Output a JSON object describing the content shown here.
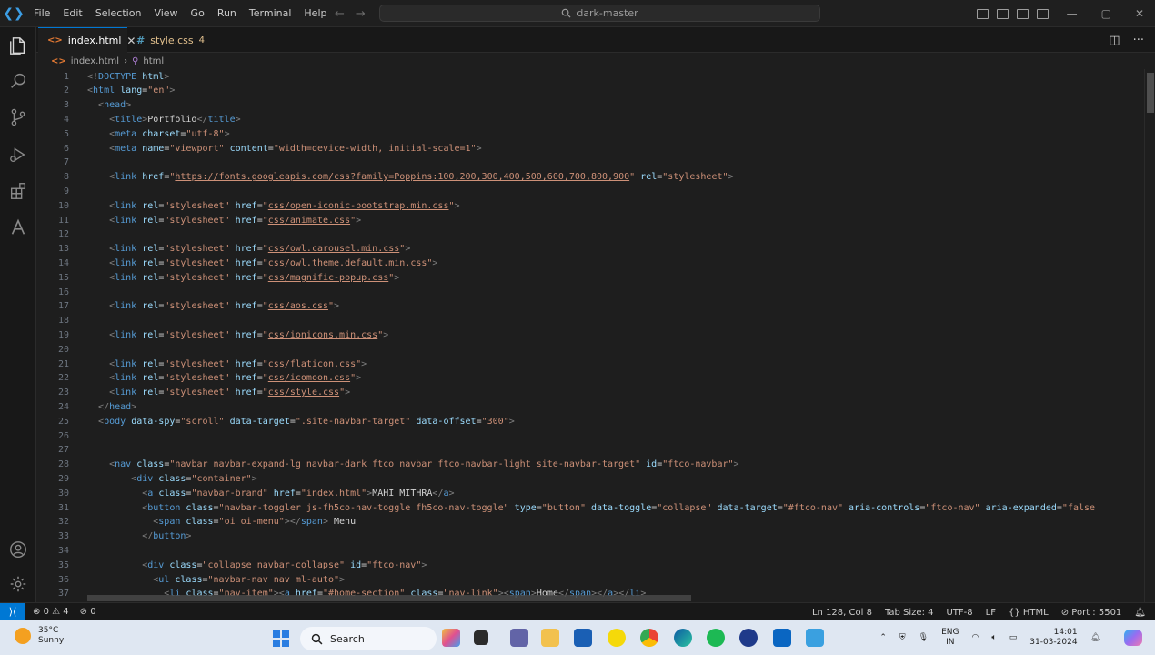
{
  "titlebar": {
    "menu": [
      "File",
      "Edit",
      "Selection",
      "View",
      "Go",
      "Run",
      "Terminal",
      "Help"
    ],
    "search": "dark-master"
  },
  "tabs": [
    {
      "label": "index.html",
      "icon": "html-file-icon",
      "active": true
    },
    {
      "label": "style.css",
      "badge": "4",
      "icon": "css-file-icon",
      "active": false
    }
  ],
  "breadcrumb": {
    "file": "index.html",
    "symbol": "html"
  },
  "editor": {
    "lines": [
      {
        "n": "1",
        "html": "<span class=\"p\">&lt;!</span><span class=\"t\">DOCTYPE</span> <span class=\"a\">html</span><span class=\"p\">&gt;</span>"
      },
      {
        "n": "2",
        "html": "<span class=\"p\">&lt;</span><span class=\"t\">html</span> <span class=\"a\">lang</span><span class=\"x\">=</span><span class=\"s\">\"en\"</span><span class=\"p\">&gt;</span>"
      },
      {
        "n": "3",
        "html": "  <span class=\"p\">&lt;</span><span class=\"t\">head</span><span class=\"p\">&gt;</span>"
      },
      {
        "n": "4",
        "html": "    <span class=\"p\">&lt;</span><span class=\"t\">title</span><span class=\"p\">&gt;</span><span class=\"x\">Portfolio</span><span class=\"p\">&lt;/</span><span class=\"t\">title</span><span class=\"p\">&gt;</span>"
      },
      {
        "n": "5",
        "html": "    <span class=\"p\">&lt;</span><span class=\"t\">meta</span> <span class=\"a\">charset</span><span class=\"x\">=</span><span class=\"s\">\"utf-8\"</span><span class=\"p\">&gt;</span>"
      },
      {
        "n": "6",
        "html": "    <span class=\"p\">&lt;</span><span class=\"t\">meta</span> <span class=\"a\">name</span><span class=\"x\">=</span><span class=\"s\">\"viewport\"</span> <span class=\"a\">content</span><span class=\"x\">=</span><span class=\"s\">\"width=device-width, initial-scale=1\"</span><span class=\"p\">&gt;</span>"
      },
      {
        "n": "7",
        "html": ""
      },
      {
        "n": "8",
        "html": "    <span class=\"p\">&lt;</span><span class=\"t\">link</span> <span class=\"a\">href</span><span class=\"x\">=</span><span class=\"s\">\"</span><span class=\"u\">https://fonts.googleapis.com/css?family=Poppins:100,200,300,400,500,600,700,800,900</span><span class=\"s\">\"</span> <span class=\"a\">rel</span><span class=\"x\">=</span><span class=\"s\">\"stylesheet\"</span><span class=\"p\">&gt;</span>"
      },
      {
        "n": "9",
        "html": ""
      },
      {
        "n": "10",
        "html": "    <span class=\"p\">&lt;</span><span class=\"t\">link</span> <span class=\"a\">rel</span><span class=\"x\">=</span><span class=\"s\">\"stylesheet\"</span> <span class=\"a\">href</span><span class=\"x\">=</span><span class=\"s\">\"</span><span class=\"u\">css/open-iconic-bootstrap.min.css</span><span class=\"s\">\"</span><span class=\"p\">&gt;</span>"
      },
      {
        "n": "11",
        "html": "    <span class=\"p\">&lt;</span><span class=\"t\">link</span> <span class=\"a\">rel</span><span class=\"x\">=</span><span class=\"s\">\"stylesheet\"</span> <span class=\"a\">href</span><span class=\"x\">=</span><span class=\"s\">\"</span><span class=\"u\">css/animate.css</span><span class=\"s\">\"</span><span class=\"p\">&gt;</span>"
      },
      {
        "n": "12",
        "html": ""
      },
      {
        "n": "13",
        "html": "    <span class=\"p\">&lt;</span><span class=\"t\">link</span> <span class=\"a\">rel</span><span class=\"x\">=</span><span class=\"s\">\"stylesheet\"</span> <span class=\"a\">href</span><span class=\"x\">=</span><span class=\"s\">\"</span><span class=\"u\">css/owl.carousel.min.css</span><span class=\"s\">\"</span><span class=\"p\">&gt;</span>"
      },
      {
        "n": "14",
        "html": "    <span class=\"p\">&lt;</span><span class=\"t\">link</span> <span class=\"a\">rel</span><span class=\"x\">=</span><span class=\"s\">\"stylesheet\"</span> <span class=\"a\">href</span><span class=\"x\">=</span><span class=\"s\">\"</span><span class=\"u\">css/owl.theme.default.min.css</span><span class=\"s\">\"</span><span class=\"p\">&gt;</span>"
      },
      {
        "n": "15",
        "html": "    <span class=\"p\">&lt;</span><span class=\"t\">link</span> <span class=\"a\">rel</span><span class=\"x\">=</span><span class=\"s\">\"stylesheet\"</span> <span class=\"a\">href</span><span class=\"x\">=</span><span class=\"s\">\"</span><span class=\"u\">css/magnific-popup.css</span><span class=\"s\">\"</span><span class=\"p\">&gt;</span>"
      },
      {
        "n": "16",
        "html": ""
      },
      {
        "n": "17",
        "html": "    <span class=\"p\">&lt;</span><span class=\"t\">link</span> <span class=\"a\">rel</span><span class=\"x\">=</span><span class=\"s\">\"stylesheet\"</span> <span class=\"a\">href</span><span class=\"x\">=</span><span class=\"s\">\"</span><span class=\"u\">css/aos.css</span><span class=\"s\">\"</span><span class=\"p\">&gt;</span>"
      },
      {
        "n": "18",
        "html": ""
      },
      {
        "n": "19",
        "html": "    <span class=\"p\">&lt;</span><span class=\"t\">link</span> <span class=\"a\">rel</span><span class=\"x\">=</span><span class=\"s\">\"stylesheet\"</span> <span class=\"a\">href</span><span class=\"x\">=</span><span class=\"s\">\"</span><span class=\"u\">css/ionicons.min.css</span><span class=\"s\">\"</span><span class=\"p\">&gt;</span>"
      },
      {
        "n": "20",
        "html": ""
      },
      {
        "n": "21",
        "html": "    <span class=\"p\">&lt;</span><span class=\"t\">link</span> <span class=\"a\">rel</span><span class=\"x\">=</span><span class=\"s\">\"stylesheet\"</span> <span class=\"a\">href</span><span class=\"x\">=</span><span class=\"s\">\"</span><span class=\"u\">css/flaticon.css</span><span class=\"s\">\"</span><span class=\"p\">&gt;</span>"
      },
      {
        "n": "22",
        "html": "    <span class=\"p\">&lt;</span><span class=\"t\">link</span> <span class=\"a\">rel</span><span class=\"x\">=</span><span class=\"s\">\"stylesheet\"</span> <span class=\"a\">href</span><span class=\"x\">=</span><span class=\"s\">\"</span><span class=\"u\">css/icomoon.css</span><span class=\"s\">\"</span><span class=\"p\">&gt;</span>"
      },
      {
        "n": "23",
        "html": "    <span class=\"p\">&lt;</span><span class=\"t\">link</span> <span class=\"a\">rel</span><span class=\"x\">=</span><span class=\"s\">\"stylesheet\"</span> <span class=\"a\">href</span><span class=\"x\">=</span><span class=\"s\">\"</span><span class=\"u\">css/style.css</span><span class=\"s\">\"</span><span class=\"p\">&gt;</span>"
      },
      {
        "n": "24",
        "html": "  <span class=\"p\">&lt;/</span><span class=\"t\">head</span><span class=\"p\">&gt;</span>"
      },
      {
        "n": "25",
        "html": "  <span class=\"p\">&lt;</span><span class=\"t\">body</span> <span class=\"a\">data-spy</span><span class=\"x\">=</span><span class=\"s\">\"scroll\"</span> <span class=\"a\">data-target</span><span class=\"x\">=</span><span class=\"s\">\".site-navbar-target\"</span> <span class=\"a\">data-offset</span><span class=\"x\">=</span><span class=\"s\">\"300\"</span><span class=\"p\">&gt;</span>"
      },
      {
        "n": "26",
        "html": ""
      },
      {
        "n": "27",
        "html": ""
      },
      {
        "n": "28",
        "html": "    <span class=\"p\">&lt;</span><span class=\"t\">nav</span> <span class=\"a\">class</span><span class=\"x\">=</span><span class=\"s\">\"navbar navbar-expand-lg navbar-dark ftco_navbar ftco-navbar-light site-navbar-target\"</span> <span class=\"a\">id</span><span class=\"x\">=</span><span class=\"s\">\"ftco-navbar\"</span><span class=\"p\">&gt;</span>"
      },
      {
        "n": "29",
        "html": "        <span class=\"p\">&lt;</span><span class=\"t\">div</span> <span class=\"a\">class</span><span class=\"x\">=</span><span class=\"s\">\"container\"</span><span class=\"p\">&gt;</span>"
      },
      {
        "n": "30",
        "html": "          <span class=\"p\">&lt;</span><span class=\"t\">a</span> <span class=\"a\">class</span><span class=\"x\">=</span><span class=\"s\">\"navbar-brand\"</span> <span class=\"a\">href</span><span class=\"x\">=</span><span class=\"s\">\"index.html\"</span><span class=\"p\">&gt;</span><span class=\"x\">MAHI MITHRA</span><span class=\"p\">&lt;/</span><span class=\"t\">a</span><span class=\"p\">&gt;</span>"
      },
      {
        "n": "31",
        "html": "          <span class=\"p\">&lt;</span><span class=\"t\">button</span> <span class=\"a\">class</span><span class=\"x\">=</span><span class=\"s\">\"navbar-toggler js-fh5co-nav-toggle fh5co-nav-toggle\"</span> <span class=\"a\">type</span><span class=\"x\">=</span><span class=\"s\">\"button\"</span> <span class=\"a\">data-toggle</span><span class=\"x\">=</span><span class=\"s\">\"collapse\"</span> <span class=\"a\">data-target</span><span class=\"x\">=</span><span class=\"s\">\"#ftco-nav\"</span> <span class=\"a\">aria-controls</span><span class=\"x\">=</span><span class=\"s\">\"ftco-nav\"</span> <span class=\"a\">aria-expanded</span><span class=\"x\">=</span><span class=\"s\">\"false</span>"
      },
      {
        "n": "32",
        "html": "            <span class=\"p\">&lt;</span><span class=\"t\">span</span> <span class=\"a\">class</span><span class=\"x\">=</span><span class=\"s\">\"oi oi-menu\"</span><span class=\"p\">&gt;&lt;/</span><span class=\"t\">span</span><span class=\"p\">&gt;</span> <span class=\"x\">Menu</span>"
      },
      {
        "n": "33",
        "html": "          <span class=\"p\">&lt;/</span><span class=\"t\">button</span><span class=\"p\">&gt;</span>"
      },
      {
        "n": "34",
        "html": ""
      },
      {
        "n": "35",
        "html": "          <span class=\"p\">&lt;</span><span class=\"t\">div</span> <span class=\"a\">class</span><span class=\"x\">=</span><span class=\"s\">\"collapse navbar-collapse\"</span> <span class=\"a\">id</span><span class=\"x\">=</span><span class=\"s\">\"ftco-nav\"</span><span class=\"p\">&gt;</span>"
      },
      {
        "n": "36",
        "html": "            <span class=\"p\">&lt;</span><span class=\"t\">ul</span> <span class=\"a\">class</span><span class=\"x\">=</span><span class=\"s\">\"navbar-nav nav ml-auto\"</span><span class=\"p\">&gt;</span>"
      },
      {
        "n": "37",
        "html": "              <span class=\"p\">&lt;</span><span class=\"t\">li</span> <span class=\"a\">class</span><span class=\"x\">=</span><span class=\"s\">\"nav-item\"</span><span class=\"p\">&gt;&lt;</span><span class=\"t\">a</span> <span class=\"a\">href</span><span class=\"x\">=</span><span class=\"s\">\"#home-section\"</span> <span class=\"a\">class</span><span class=\"x\">=</span><span class=\"s\">\"nav-link\"</span><span class=\"p\">&gt;&lt;</span><span class=\"t\">span</span><span class=\"p\">&gt;</span><span class=\"x\">Home</span><span class=\"p\">&lt;/</span><span class=\"t\">span</span><span class=\"p\">&gt;&lt;/</span><span class=\"t\">a</span><span class=\"p\">&gt;&lt;/</span><span class=\"t\">li</span><span class=\"p\">&gt;</span>"
      }
    ]
  },
  "statusbar": {
    "errors": "0",
    "warnings": "4",
    "ports": "0",
    "position": "Ln 128, Col 8",
    "tab_size": "Tab Size: 4",
    "encoding": "UTF-8",
    "eol": "LF",
    "language": "HTML",
    "port": "Port : 5501"
  },
  "taskbar": {
    "temperature": "35°C",
    "condition": "Sunny",
    "search_label": "Search",
    "lang_top": "ENG",
    "lang_bottom": "IN",
    "time": "14:01",
    "date": "31-03-2024"
  },
  "colors": {
    "accent": "#0078d4",
    "tag": "#569cd6",
    "attribute": "#9cdcfe",
    "string": "#ce9178"
  }
}
